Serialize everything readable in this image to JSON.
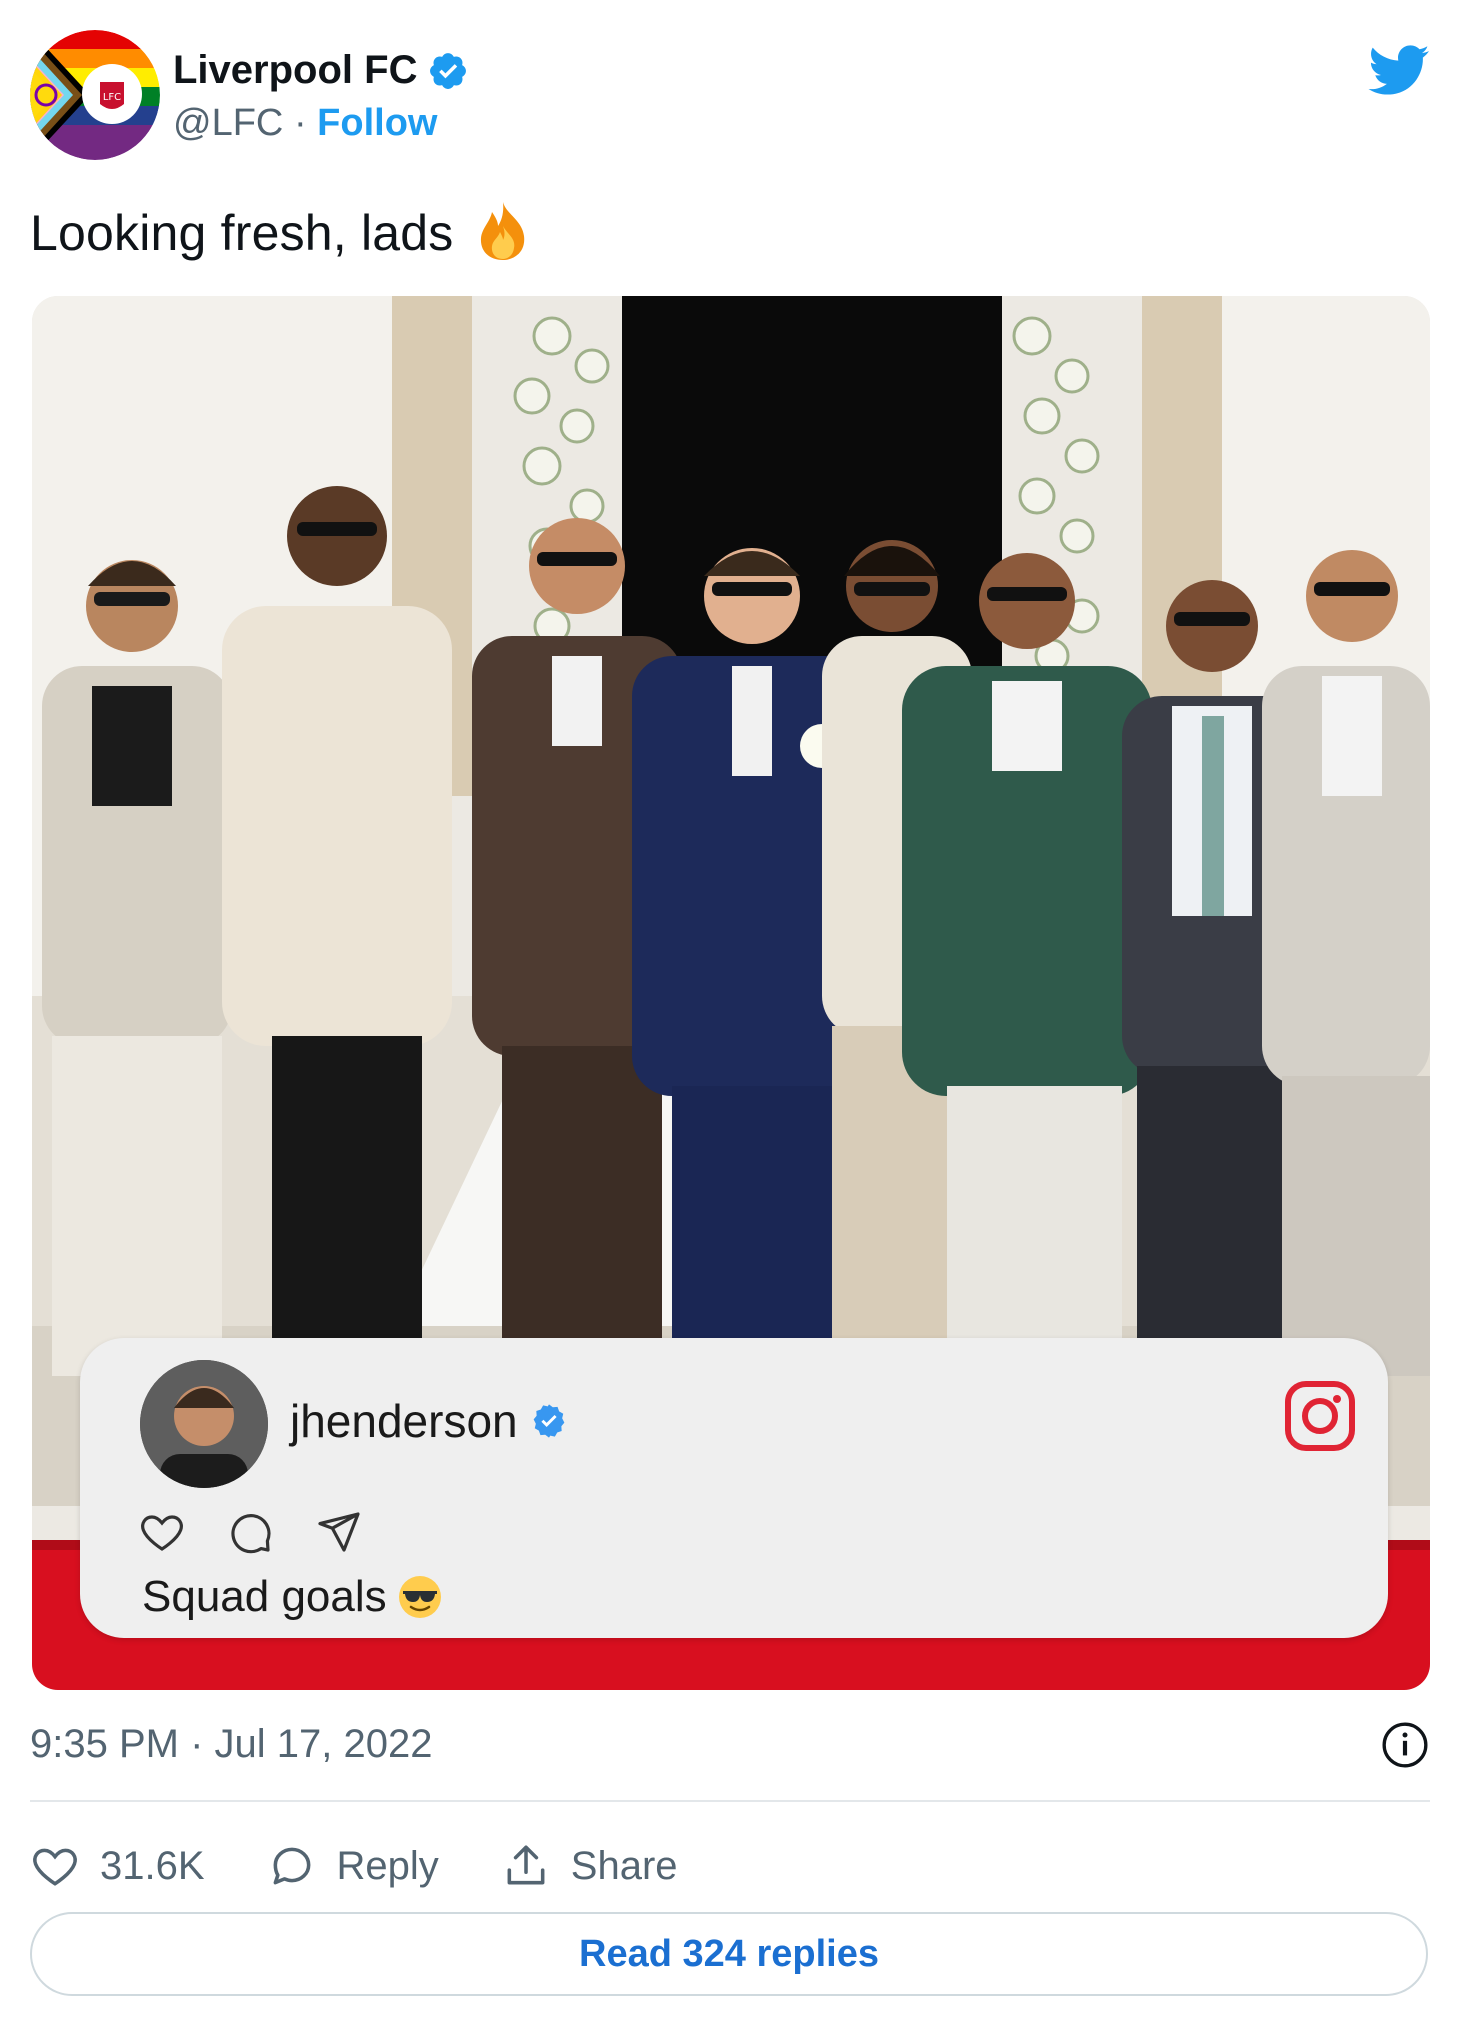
{
  "account": {
    "display_name": "Liverpool FC",
    "handle": "@LFC",
    "separator": "·",
    "follow_label": "Follow",
    "avatar_icon": "liverpool-crest-pride-avatar",
    "verified_icon": "verified-badge-icon"
  },
  "tweet": {
    "text": "Looking fresh, lads",
    "emoji_icon": "fire-emoji-icon"
  },
  "media": {
    "image_desc_icon": "group-photo",
    "instagram_card": {
      "username": "jhenderson",
      "caption": "Squad goals",
      "caption_emoji_icon": "sunglasses-emoji-icon",
      "actions": [
        "heart-icon",
        "comment-icon",
        "send-icon"
      ]
    }
  },
  "meta": {
    "timestamp": "9:35 PM · Jul 17, 2022"
  },
  "actions": {
    "likes_count": "31.6K",
    "reply_label": "Reply",
    "share_label": "Share"
  },
  "read_replies_label": "Read 324 replies",
  "colors": {
    "twitter_blue": "#1d9bf0",
    "link_blue": "#1b6fd1",
    "text_secondary": "#536471",
    "instagram_red": "#e02434",
    "lfc_red": "#d80f1f"
  }
}
